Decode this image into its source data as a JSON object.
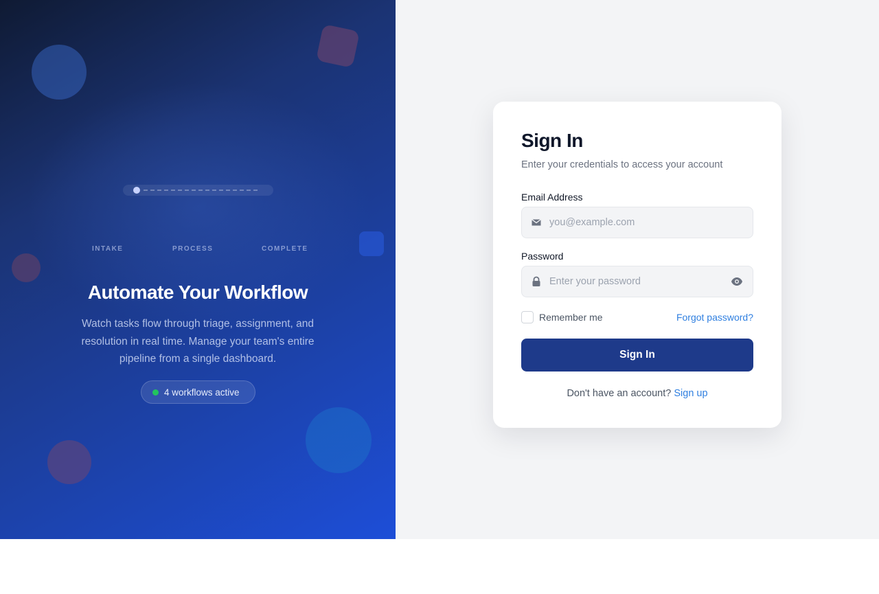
{
  "hero": {
    "stages": [
      "INTAKE",
      "PROCESS",
      "COMPLETE"
    ],
    "title": "Automate Your Workflow",
    "description": "Watch tasks flow through triage, assignment, and resolution in real time. Manage your team's entire pipeline from a single dashboard.",
    "status": "4 workflows active",
    "status_color": "#22c55e"
  },
  "form": {
    "title": "Sign In",
    "subtitle": "Enter your credentials to access your account",
    "email_label": "Email Address",
    "email_value": "",
    "email_placeholder": "you@example.com",
    "email_icon": "envelope-icon",
    "password_label": "Password",
    "password_value": "",
    "password_placeholder": "Enter your password",
    "password_icon": "lock-icon",
    "toggle_icon": "eye-icon",
    "remember_label": "Remember me",
    "remember_checked": false,
    "forgot_label": "Forgot password?",
    "submit_label": "Sign In",
    "signup_prompt": "Don't have an account?",
    "signup_link": "Sign up"
  },
  "colors": {
    "primary_button": "#1e3a8a",
    "link": "#2f7fe0"
  }
}
